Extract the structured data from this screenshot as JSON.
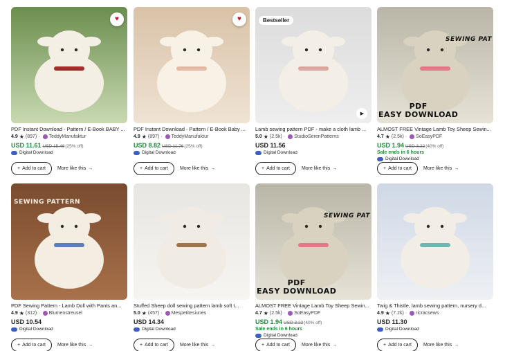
{
  "cards": [
    {
      "title": "PDF Instant Download - Pattern / E-Book BABY ...",
      "rating": "4.9",
      "reviews": "(897)",
      "shop": "TeddyManufaktur",
      "price": "USD 11.61",
      "was": "USD 15.48",
      "off": "(25% off)",
      "sale_ends": "",
      "digital": "Digital Download",
      "badge": "",
      "favorite": true,
      "video": false,
      "overlay1": "",
      "overlay2": "",
      "colors": {
        "bg1": "#6b8e4e",
        "bg2": "#c9d9b2",
        "subject": "#f4efe4",
        "accent": "#a52a2a"
      }
    },
    {
      "title": "PDF Instant Download - Pattern / E-Book Baby ...",
      "rating": "4.9",
      "reviews": "(897)",
      "shop": "TeddyManufaktur",
      "price": "USD 8.82",
      "was": "USD 11.76",
      "off": "(25% off)",
      "sale_ends": "",
      "digital": "Digital Download",
      "badge": "",
      "favorite": true,
      "video": false,
      "overlay1": "",
      "overlay2": "",
      "colors": {
        "bg1": "#d9c2a8",
        "bg2": "#efe3d3",
        "subject": "#f7f1e6",
        "accent": "#e3b9a5"
      }
    },
    {
      "title": "Lamb sewing pattern PDF - make a cloth lamb ...",
      "rating": "5.0",
      "reviews": "(2.5k)",
      "shop": "StudioSerenPatterns",
      "price": "USD 11.56",
      "was": "",
      "off": "",
      "sale_ends": "",
      "digital": "Digital Download",
      "badge": "Bestseller",
      "favorite": false,
      "video": true,
      "overlay1": "",
      "overlay2": "",
      "colors": {
        "bg1": "#dcdcdc",
        "bg2": "#eeeeee",
        "subject": "#f3eee6",
        "accent": "#d9a7a0"
      }
    },
    {
      "title": "ALMOST FREE Vintage Lamb Toy Sheep Sewin...",
      "rating": "4.7",
      "reviews": "(2.5k)",
      "shop": "SoEasyPDF",
      "price": "USD 1.94",
      "was": "USD 3.22",
      "off": "(40% off)",
      "sale_ends": "Sale ends in 6 hours",
      "digital": "Digital Download",
      "badge": "",
      "favorite": false,
      "video": false,
      "overlay1": "SEWING PAT",
      "overlay2": "PDF\nEASY DOWNLOAD",
      "colors": {
        "bg1": "#b9b6a8",
        "bg2": "#e6e2d6",
        "subject": "#d9d2c0",
        "accent": "#e07a8a"
      }
    },
    {
      "title": "PDF Sewing Pattern - Lamb Doll with Pants an...",
      "rating": "4.9",
      "reviews": "(312)",
      "shop": "Blumenstreusel",
      "price": "USD 10.54",
      "was": "",
      "off": "",
      "sale_ends": "",
      "digital": "Digital Download",
      "badge": "",
      "favorite": false,
      "video": false,
      "overlay1": "SEWING PATTERN",
      "overlay2": "",
      "colors": {
        "bg1": "#7a4b2f",
        "bg2": "#a8714a",
        "subject": "#f3ede2",
        "accent": "#5b7fb5"
      }
    },
    {
      "title": "Stuffed Sheep doll sewing pattern lamb soft t...",
      "rating": "5.0",
      "reviews": "(457)",
      "shop": "Mespetitesiunes",
      "price": "USD 14.34",
      "was": "",
      "off": "",
      "sale_ends": "",
      "digital": "Digital Download",
      "badge": "",
      "favorite": false,
      "video": false,
      "overlay1": "",
      "overlay2": "",
      "colors": {
        "bg1": "#e8e6e2",
        "bg2": "#f6f5f2",
        "subject": "#f1ece3",
        "accent": "#a0744a"
      }
    },
    {
      "title": "ALMOST FREE Vintage Lamb Toy Sheep Sewin...",
      "rating": "4.7",
      "reviews": "(2.5k)",
      "shop": "SoEasyPDF",
      "price": "USD 1.94",
      "was": "USD 3.22",
      "off": "(40% off)",
      "sale_ends": "Sale ends in 6 hours",
      "digital": "Digital Download",
      "badge": "",
      "favorite": false,
      "video": false,
      "overlay1": "SEWING PAT",
      "overlay2": "PDF\nEASY DOWNLOAD",
      "colors": {
        "bg1": "#b9b6a8",
        "bg2": "#e6e2d6",
        "subject": "#d9d2c0",
        "accent": "#e07a8a"
      }
    },
    {
      "title": "Twig & Thistle, lamb sewing pattern, nursery d...",
      "rating": "4.9",
      "reviews": "(7.2k)",
      "shop": "ricracsews",
      "price": "USD 11.30",
      "was": "",
      "off": "",
      "sale_ends": "",
      "digital": "Digital Download",
      "badge": "",
      "favorite": false,
      "video": false,
      "overlay1": "",
      "overlay2": "",
      "colors": {
        "bg1": "#cfd8e6",
        "bg2": "#eef0f4",
        "subject": "#f2eee6",
        "accent": "#6fb6b3"
      }
    }
  ],
  "labels": {
    "add_to_cart": "Add to cart",
    "more_like_this": "More like this"
  },
  "icons": {
    "star": "★",
    "arrow": "→",
    "plus": "+",
    "heart": "♥",
    "play": "▶"
  }
}
